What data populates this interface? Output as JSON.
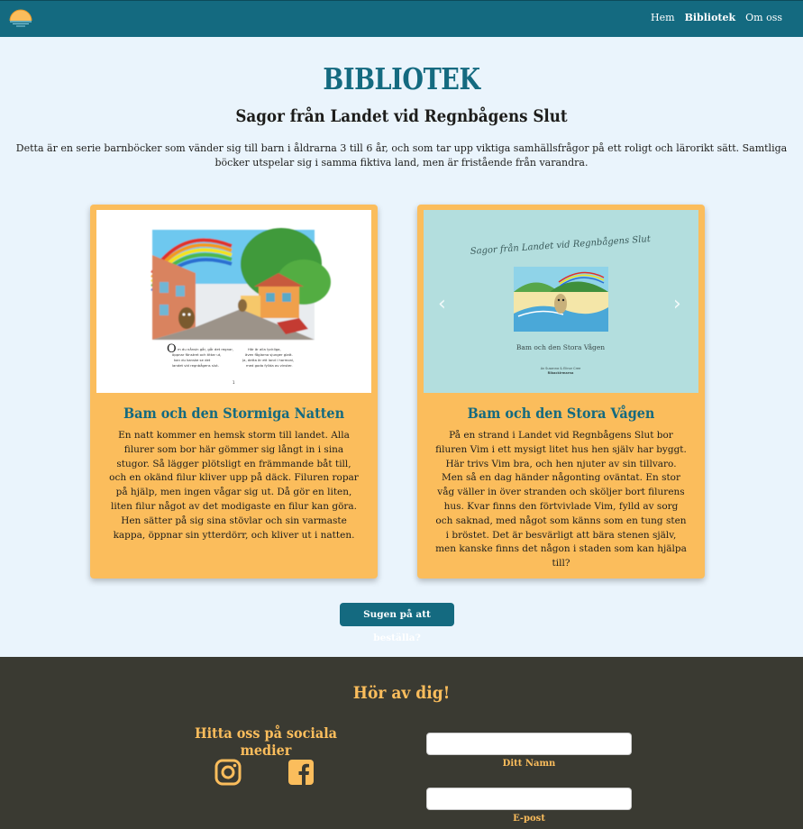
{
  "nav": {
    "links": [
      "Hem",
      "Bibliotek",
      "Om oss"
    ],
    "active": "Bibliotek"
  },
  "main": {
    "title": "BIBLIOTEK",
    "subtitle": "Sagor från Landet vid Regnbågens Slut",
    "intro": "Detta är en serie barnböcker som vänder sig till barn i åldrarna 3 till 6 år, och som tar upp viktiga samhällsfrågor på ett roligt och lärorikt sätt. Samtliga böcker utspelar sig i samma fiktiva land, men är fristående från varandra."
  },
  "books": [
    {
      "title": "Bam och den Stormiga Natten",
      "description": "En natt kommer en hemsk storm till landet. Alla filurer som bor här gömmer sig långt in i sina stugor. Så lägger plötsligt en främmande båt till, och en okänd filur kliver upp på däck. Filuren ropar på hjälp, men ingen vågar sig ut. Då gör en liten, liten filur något av det modigaste en filur kan göra. Hen sätter på sig sina stövlar och sin varmaste kappa, öppnar sin ytterdörr, och kliver ut i natten.",
      "image_caption": "Om du nånsin går, går det regnar, öppnar fönstret och tittar ut, kan du kanske se det landet vid regnbågens slut.",
      "image_caption_2": "Här är alla lyckliga, även fåglarna sjunger glatt. Ja, detta är ett land i harmoni, med goda fyllda av vinster.",
      "page_number": "1"
    },
    {
      "title": "Bam och den Stora Vågen",
      "description": "På en strand i Landet vid Regnbågens Slut bor filuren Vim i ett mysigt litet hus hen själv har byggt. Här trivs Vim bra, och hen njuter av sin tillvaro. Men så en dag händer någonting oväntat. En stor våg väller in över stranden och sköljer bort filurens hus. Kvar finns den förtvivlade Vim, fylld av sorg och saknad, med något som känns som en tung sten i bröstet. Det är besvärligt att bära stenen själv, men kanske finns det någon i staden som kan hjälpa till?",
      "cover_series": "Sagor från Landet vid Regnbågens Slut",
      "cover_title": "Bam och den Stora Vågen",
      "cover_authors": "Av Susanna & Elinor Cree",
      "cover_publisher": "Ribackirmarna"
    }
  ],
  "order_button": "Sugen på att beställa?",
  "footer": {
    "title": "Hör av dig!",
    "social_title": "Hitta oss på sociala medier",
    "name_label": "Ditt Namn",
    "email_label": "E-post"
  },
  "colors": {
    "brand": "#146a80",
    "accent": "#fbbd5c",
    "footer_bg": "#3a3a32",
    "page_bg": "#eaf4fc"
  },
  "icons": [
    "sunset-logo-icon",
    "chevron-left-icon",
    "chevron-right-icon",
    "instagram-icon",
    "facebook-icon"
  ]
}
